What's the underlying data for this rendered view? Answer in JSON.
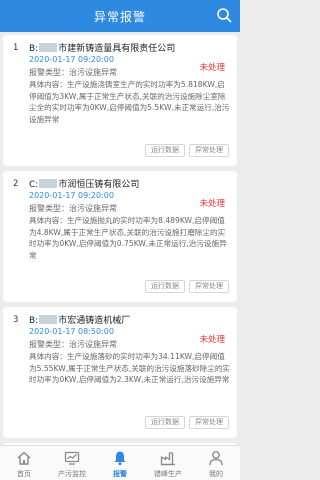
{
  "header": {
    "title": "异常报警"
  },
  "cards": [
    {
      "num": "1",
      "company_prefix": "B:",
      "company_suffix": "市建新铸造量具有限责任公司",
      "time": "2020-01-17 09:20:00",
      "status": "未处理",
      "type": "报警类型：治污设施异常",
      "content": "具体内容：生产设施浇铸室生产的实时功率为5.818KW,启停阈值为3KW,属于正常生产状态,关联的治污设施除尘室除尘全的实时功率为0KW,启停阈值为5.5KW,未正常运行,治污设施异常",
      "btn_data": "运行数据",
      "btn_handle": "异常处理"
    },
    {
      "num": "2",
      "company_prefix": "C:",
      "company_suffix": "市润恒压铸有限公司",
      "time": "2020-01-17 09:20:00",
      "status": "未处理",
      "type": "报警类型：治污设施异常",
      "content": "具体内容：生产设施抛丸的实时功率为8.489KW,启停阈值为4.8KW,属于正常生产状态,关联的治污设施打磨除尘的实时功率为0KW,启停阈值为0.75KW,未正常运行,治污设施异常",
      "btn_data": "运行数据",
      "btn_handle": "异常处理"
    },
    {
      "num": "3",
      "company_prefix": "B:",
      "company_suffix": "市宏通铸造机械厂",
      "time": "2020-01-17 08:50:00",
      "status": "未处理",
      "type": "报警类型：治污设施异常",
      "content": "具体内容：生产设施落砂的实时功率为34.11KW,启停阈值为5.55KW,属于正常生产状态,关联的治污设施落砂除尘的实时功率为0KW,启停阈值为2.3KW,未正常运行,治污设施异常",
      "btn_data": "运行数据",
      "btn_handle": "异常处理"
    }
  ],
  "tabs": [
    {
      "label": "首页",
      "icon": "home-icon"
    },
    {
      "label": "产污监控",
      "icon": "monitor-icon"
    },
    {
      "label": "报警",
      "icon": "bell-icon",
      "active": true
    },
    {
      "label": "错峰生产",
      "icon": "factory-icon"
    },
    {
      "label": "我的",
      "icon": "user-icon"
    }
  ],
  "colors": {
    "primary": "#2d8ae0",
    "alert": "#e23a3a"
  }
}
